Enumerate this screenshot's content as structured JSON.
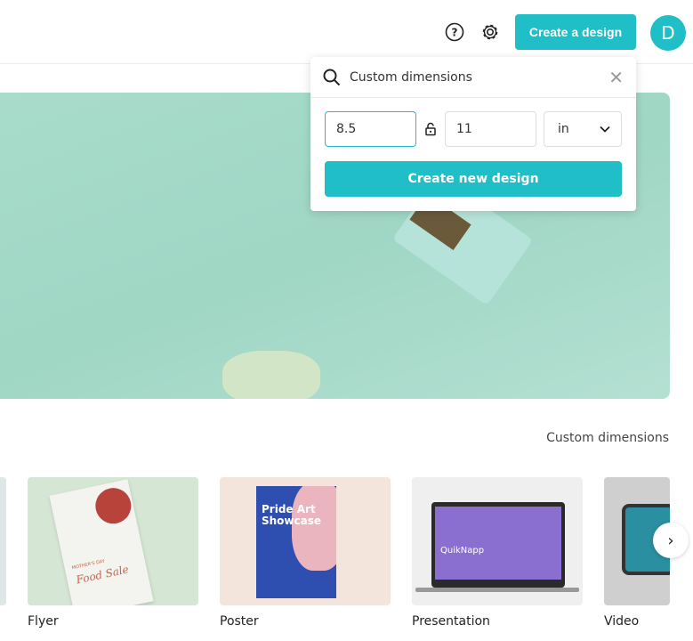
{
  "header": {
    "help_icon": "question-circle-icon",
    "settings_icon": "gear-icon",
    "create_label": "Create a design",
    "avatar_initial": "D"
  },
  "popup": {
    "search_placeholder": "Custom dimensions",
    "width": "8.5",
    "height": "11",
    "unit": "in",
    "create_label": "Create new design"
  },
  "section": {
    "custom_link": "Custom dimensions"
  },
  "cards": [
    {
      "label": "Flyer",
      "image_text": [
        "MOTHER'S DAY",
        "Food Sale"
      ]
    },
    {
      "label": "Poster",
      "image_text": [
        "Pride Art Showcase"
      ]
    },
    {
      "label": "Presentation",
      "image_text": [
        "QuikNapp"
      ]
    },
    {
      "label": "Video"
    }
  ],
  "colors": {
    "accent": "#20bec6"
  }
}
